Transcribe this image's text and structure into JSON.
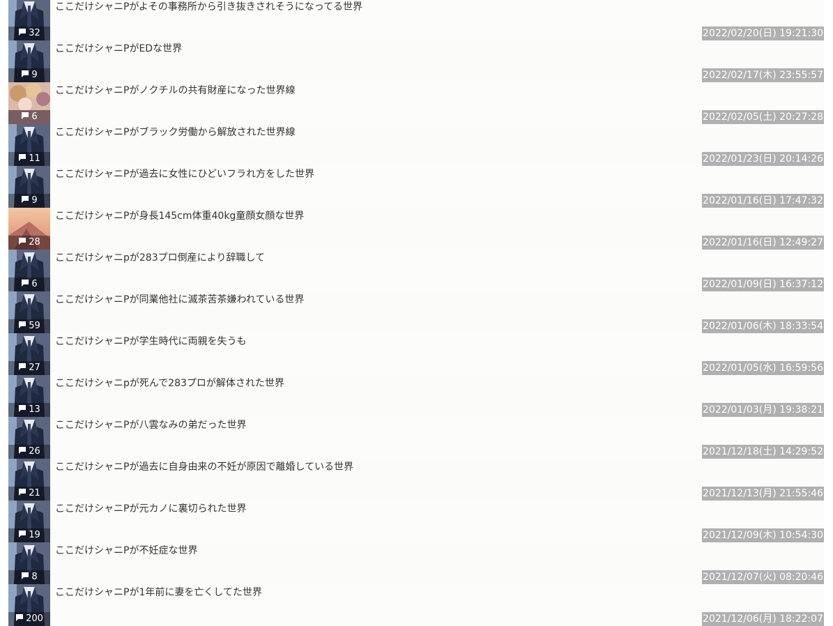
{
  "threads": [
    {
      "title": "ここだけシャニPがよその事務所から引き抜きされそうになってる世界",
      "count": "32",
      "date": "2022/02/20(日) 19:21:30",
      "thumb": "suit"
    },
    {
      "title": "ここだけシャニPがEDな世界",
      "count": "9",
      "date": "2022/02/17(木) 23:55:57",
      "thumb": "suit"
    },
    {
      "title": "ここだけシャニPがノクチルの共有財産になった世界線",
      "count": "6",
      "date": "2022/02/05(土) 20:27:28",
      "thumb": "idols"
    },
    {
      "title": "ここだけシャニPがブラック労働から解放された世界線",
      "count": "11",
      "date": "2022/01/23(日) 20:14:26",
      "thumb": "suit"
    },
    {
      "title": "ここだけシャニPが過去に女性にひどいフラれ方をした世界",
      "count": "9",
      "date": "2022/01/16(日) 17:47:32",
      "thumb": "suit"
    },
    {
      "title": "ここだけシャニPが身長145cm体重40kg童顔女顔な世界",
      "count": "28",
      "date": "2022/01/16(日) 12:49:27",
      "thumb": "sunset"
    },
    {
      "title": "ここだけシャニpが283プロ倒産により辞職して",
      "count": "6",
      "date": "2022/01/09(日) 16:37:12",
      "thumb": "suit"
    },
    {
      "title": "ここだけシャニPが同業他社に滅茶苦茶嫌われている世界",
      "count": "59",
      "date": "2022/01/06(木) 18:33:54",
      "thumb": "suit"
    },
    {
      "title": "ここだけシャニPが学生時代に両親を失うも",
      "count": "27",
      "date": "2022/01/05(水) 16:59:56",
      "thumb": "suit"
    },
    {
      "title": "ここだけシャニpが死んで283プロが解体された世界",
      "count": "13",
      "date": "2022/01/03(月) 19:38:21",
      "thumb": "suit"
    },
    {
      "title": "ここだけシャニPが八雲なみの弟だった世界",
      "count": "26",
      "date": "2021/12/18(土) 14:29:52",
      "thumb": "suit"
    },
    {
      "title": "ここだけシャニPが過去に自身由来の不妊が原因で離婚している世界",
      "count": "21",
      "date": "2021/12/13(月) 21:55:46",
      "thumb": "suit"
    },
    {
      "title": "ここだけシャニPが元カノに裏切られた世界",
      "count": "19",
      "date": "2021/12/09(木) 10:54:30",
      "thumb": "suit"
    },
    {
      "title": "ここだけシャニPが不妊症な世界",
      "count": "8",
      "date": "2021/12/07(火) 08:20:46",
      "thumb": "suit"
    },
    {
      "title": "ここだけシャニPが1年前に妻を亡くしてた世界",
      "count": "200",
      "date": "2021/12/06(月) 18:22:07",
      "thumb": "suit"
    }
  ],
  "icons": {
    "count": "comment-bubble-icon"
  },
  "colors": {
    "date_badge": "#b0b0b0",
    "title_text": "#333333",
    "count_overlay": "rgba(0,0,0,0.35)"
  }
}
